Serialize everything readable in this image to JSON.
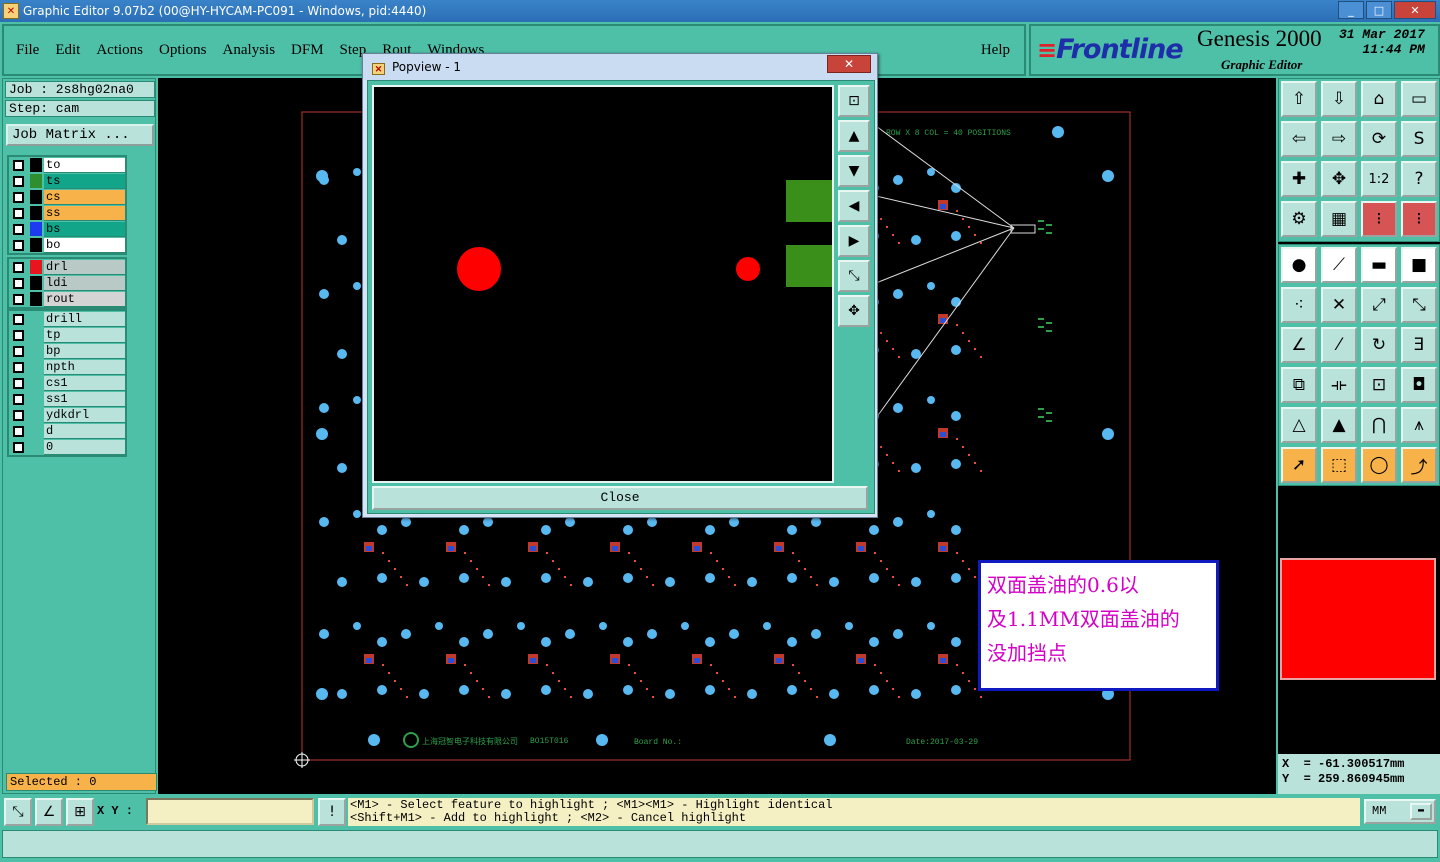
{
  "window": {
    "title": "Graphic Editor 9.07b2 (00@HY-HYCAM-PC091 - Windows, pid:4440)",
    "controls": [
      "_",
      "□",
      "✕"
    ]
  },
  "menu": {
    "items": [
      "File",
      "Edit",
      "Actions",
      "Options",
      "Analysis",
      "DFM",
      "Step",
      "Rout",
      "Windows"
    ],
    "help": "Help"
  },
  "brand": {
    "logo": "Frontline",
    "product": "Genesis 2000",
    "subtitle": "Graphic Editor",
    "date": "31 Mar 2017",
    "time": "11:44 PM"
  },
  "left": {
    "job": "Job : 2s8hg02na0",
    "step": "Step: cam",
    "job_matrix": "Job Matrix ...",
    "board_layers": [
      {
        "name": "to",
        "swatch": "#000000",
        "bg": "#ffffff"
      },
      {
        "name": "ts",
        "swatch": "#2f8f2f",
        "bg": "#13a58a"
      },
      {
        "name": "cs",
        "swatch": "#000000",
        "bg": "#f7b24a"
      },
      {
        "name": "ss",
        "swatch": "#000000",
        "bg": "#f7b24a"
      },
      {
        "name": "bs",
        "swatch": "#1d3cf0",
        "bg": "#13a58a"
      },
      {
        "name": "bo",
        "swatch": "#000000",
        "bg": "#ffffff"
      }
    ],
    "drill_layers": [
      {
        "name": "drl",
        "swatch": "#e8141e",
        "bg": "#b9c9c6"
      },
      {
        "name": "ldi",
        "swatch": "#000000",
        "bg": "#b9c9c6"
      },
      {
        "name": "rout",
        "swatch": "#000000",
        "bg": "#d4d4d4"
      }
    ],
    "misc_layers": [
      "drill",
      "tp",
      "bp",
      "npth",
      "cs1",
      "ss1",
      "ydkdrl",
      "d",
      "0"
    ],
    "selected": "Selected : 0"
  },
  "canvas": {
    "panel_text": "ROW X 8 COL = 40 POSITIONS",
    "board_no": "Board No.:",
    "date_label": "Date:2017-03-29",
    "part_no": "BO15T016",
    "company_text": "上海冠智电子科技有限公司"
  },
  "note": {
    "lines": [
      "双面盖油的0.6以",
      "及1.1MM双面盖油的",
      "没加挡点"
    ]
  },
  "popview": {
    "title": "Popview - 1",
    "close_label": "Close",
    "tool_icons": [
      "zoom-fit-icon",
      "pan-up-icon",
      "pan-down-icon",
      "pan-left-icon",
      "pan-right-icon",
      "zoom-in-icon",
      "zoom-out-icon"
    ]
  },
  "coords": {
    "x": "X  = -61.300517mm",
    "y": "Y  = 259.860945mm"
  },
  "bottom": {
    "xy_label": "X Y :",
    "xy_value": "",
    "hint_line1": "<M1> - Select feature to highlight ; <M1><M1> - Highlight identical",
    "hint_line2": "<Shift+M1> - Add to highlight ; <M2> - Cancel highlight",
    "units": "MM"
  }
}
